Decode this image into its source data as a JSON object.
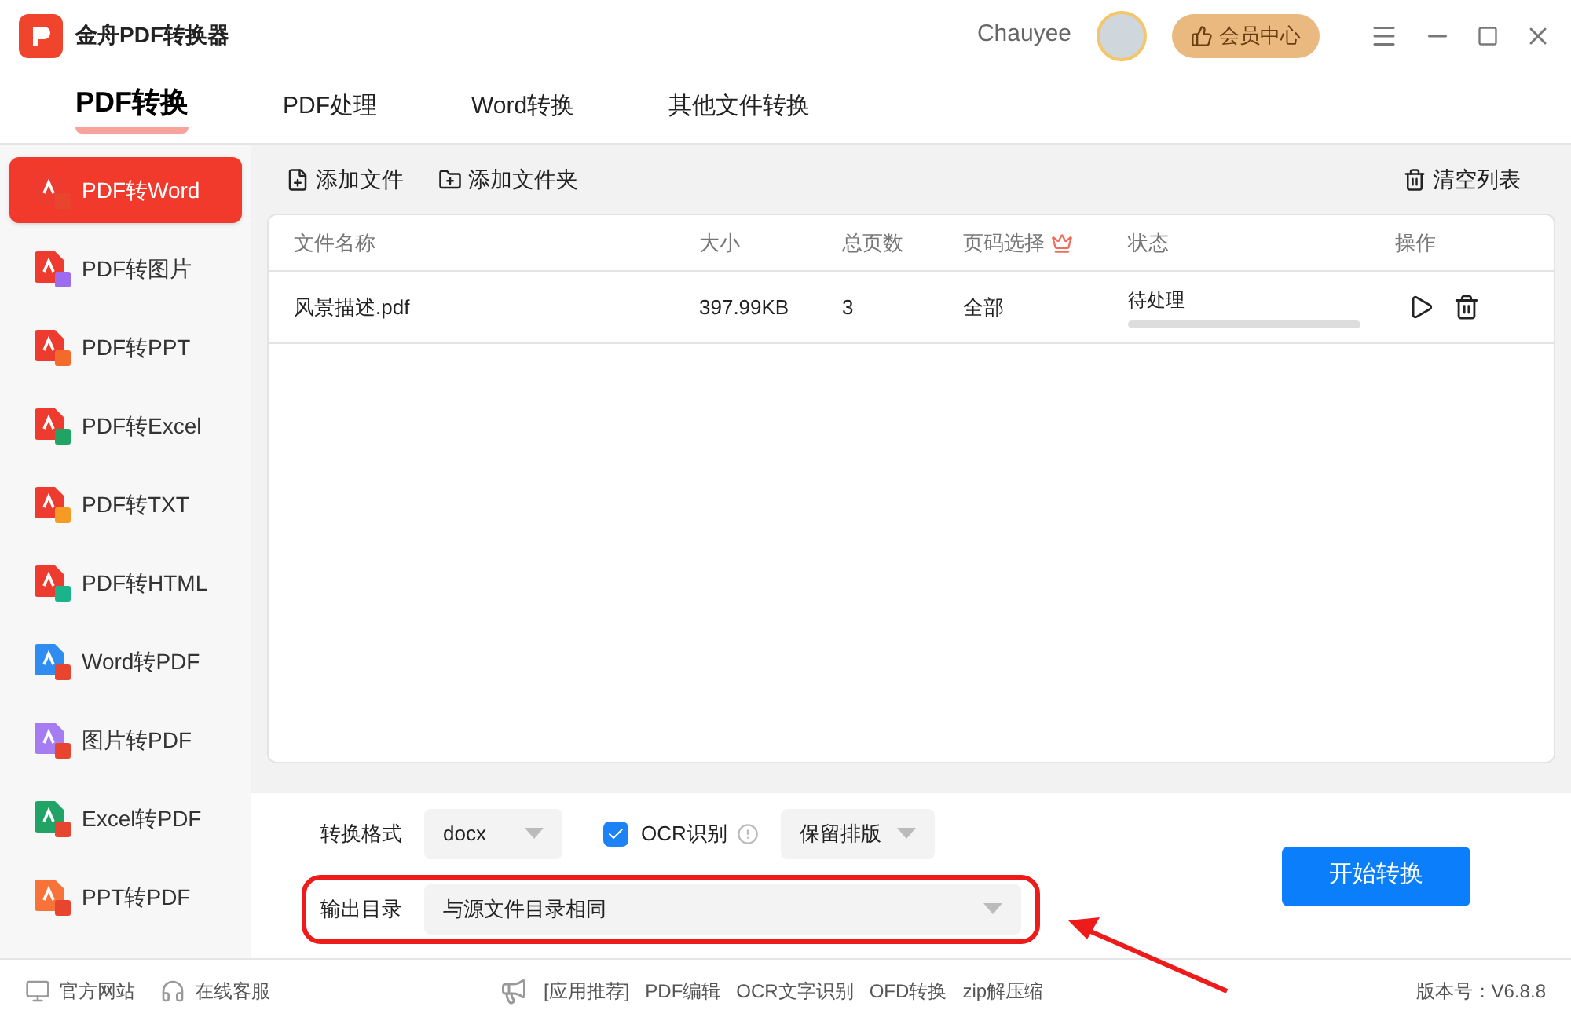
{
  "window": {
    "title": "金舟PDF转换器",
    "user": "Chauyee",
    "vip_button": "会员中心"
  },
  "tabs": [
    {
      "label": "PDF转换",
      "selected": true
    },
    {
      "label": "PDF处理",
      "selected": false
    },
    {
      "label": "Word转换",
      "selected": false
    },
    {
      "label": "其他文件转换",
      "selected": false
    }
  ],
  "sidebar": {
    "items": [
      {
        "label": "PDF转Word",
        "selected": true,
        "kind": "pdf",
        "color": "#e8452f"
      },
      {
        "label": "PDF转图片",
        "selected": false,
        "kind": "pdf",
        "color": "#9b6cf0"
      },
      {
        "label": "PDF转PPT",
        "selected": false,
        "kind": "pdf",
        "color": "#f26b2a"
      },
      {
        "label": "PDF转Excel",
        "selected": false,
        "kind": "pdf",
        "color": "#1fa463"
      },
      {
        "label": "PDF转TXT",
        "selected": false,
        "kind": "pdf",
        "color": "#f59a23"
      },
      {
        "label": "PDF转HTML",
        "selected": false,
        "kind": "pdf",
        "color": "#1bb38a"
      },
      {
        "label": "Word转PDF",
        "selected": false,
        "kind": "word",
        "color": "#e8452f"
      },
      {
        "label": "图片转PDF",
        "selected": false,
        "kind": "image",
        "color": "#e8452f"
      },
      {
        "label": "Excel转PDF",
        "selected": false,
        "kind": "excel",
        "color": "#e8452f"
      },
      {
        "label": "PPT转PDF",
        "selected": false,
        "kind": "ppt",
        "color": "#e8452f"
      }
    ]
  },
  "toolbar": {
    "add_file": "添加文件",
    "add_folder": "添加文件夹",
    "clear_list": "清空列表"
  },
  "table": {
    "columns": [
      "文件名称",
      "大小",
      "总页数",
      "页码选择",
      "状态",
      "操作"
    ],
    "rows": [
      {
        "name": "风景描述.pdf",
        "size": "397.99KB",
        "pages": "3",
        "page_range": "全部",
        "status": "待处理",
        "level": 0
      }
    ]
  },
  "options": {
    "format_label": "转换格式",
    "format": "docx",
    "ocr_label": "OCR识别",
    "ocr_checked": true,
    "layout": "保留排版",
    "output_label": "输出目录",
    "output": "与源文件目录相同",
    "start_button": "开始转换"
  },
  "status_bar": {
    "website": "官方网站",
    "support": "在线客服",
    "promo_label": "[应用推荐]",
    "links": [
      "PDF编辑",
      "OCR文字识别",
      "OFD转换",
      "zip解压缩"
    ],
    "version": "版本号：V6.8.8"
  }
}
